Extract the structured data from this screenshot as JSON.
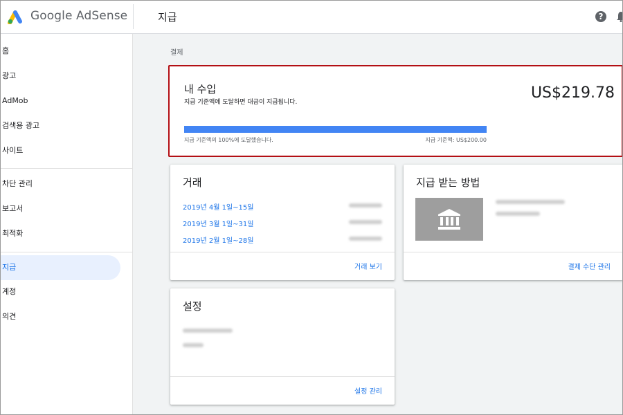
{
  "brand": {
    "name": "Google AdSense"
  },
  "header": {
    "title": "지급",
    "help_icon": "?"
  },
  "sidebar": {
    "items": [
      {
        "label": "홈"
      },
      {
        "label": "광고"
      },
      {
        "label": "AdMob"
      },
      {
        "label": "검색용 광고"
      },
      {
        "label": "사이트"
      },
      {
        "label": "차단 관리"
      },
      {
        "label": "보고서"
      },
      {
        "label": "최적화"
      },
      {
        "label": "지급",
        "active": true
      },
      {
        "label": "계정"
      },
      {
        "label": "의견"
      }
    ]
  },
  "breadcrumb": "결제",
  "earnings": {
    "title": "내 수입",
    "subtitle": "지급 기준액에 도달하면 대금이 지급됩니다.",
    "amount": "US$219.78",
    "progress_percent": 100,
    "progress_text": "지급 기준액의 100%에 도달했습니다.",
    "threshold_text": "지급 기준액: US$200.00"
  },
  "transactions": {
    "title": "거래",
    "rows": [
      {
        "period": "2019년 4월 1일~15일"
      },
      {
        "period": "2019년 3월 1일~31일"
      },
      {
        "period": "2019년 2월 1일~28일"
      }
    ],
    "view_link": "거래 보기"
  },
  "payment_method": {
    "title": "지급 받는 방법",
    "manage_link": "결제 수단 관리"
  },
  "settings": {
    "title": "설정",
    "manage_link": "설정 관리"
  },
  "colors": {
    "accent": "#1a73e8",
    "progress": "#4285f4",
    "highlight_border": "#b30f14",
    "active_nav_bg": "#e8f0fe"
  },
  "icons": {
    "logo": "adsense-logo-icon",
    "help": "help-icon",
    "notifications": "bell-icon",
    "bank": "bank-icon"
  }
}
